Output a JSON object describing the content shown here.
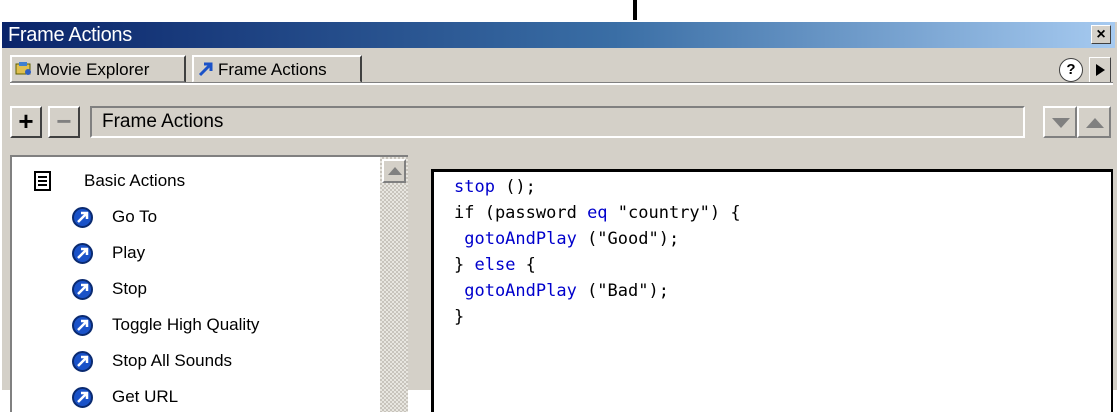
{
  "window": {
    "title": "Frame Actions",
    "close_label": "×"
  },
  "tabs": [
    {
      "label": "Movie Explorer",
      "icon": "movie-explorer-icon"
    },
    {
      "label": "Frame Actions",
      "icon": "frame-actions-icon",
      "active": true
    }
  ],
  "tabstrip": {
    "help_label": "?"
  },
  "toolbar": {
    "add_label": "+",
    "remove_label": "−",
    "name": "Frame Actions"
  },
  "toolbox": {
    "category": "Basic Actions",
    "items": [
      "Go To",
      "Play",
      "Stop",
      "Toggle High Quality",
      "Stop All Sounds",
      "Get URL"
    ]
  },
  "code": {
    "lines": [
      {
        "segments": [
          {
            "t": "stop ",
            "kw": true
          },
          {
            "t": "();",
            "kw": false
          }
        ]
      },
      {
        "segments": [
          {
            "t": "if (password ",
            "kw": false
          },
          {
            "t": "eq",
            "kw": true
          },
          {
            "t": " \"country\") {",
            "kw": false
          }
        ]
      },
      {
        "segments": [
          {
            "t": " gotoAndPlay",
            "kw": true
          },
          {
            "t": " (\"Good\");",
            "kw": false
          }
        ]
      },
      {
        "segments": [
          {
            "t": "} ",
            "kw": false
          },
          {
            "t": "else",
            "kw": true
          },
          {
            "t": " {",
            "kw": false
          }
        ]
      },
      {
        "segments": [
          {
            "t": " gotoAndPlay",
            "kw": true
          },
          {
            "t": " (\"Bad\");",
            "kw": false
          }
        ]
      },
      {
        "segments": [
          {
            "t": "}",
            "kw": false
          }
        ]
      }
    ]
  },
  "colors": {
    "keyword": "#0000cc",
    "titlebar_start": "#0a246a",
    "titlebar_end": "#a6caf0",
    "action_icon": "#1a52c8"
  }
}
